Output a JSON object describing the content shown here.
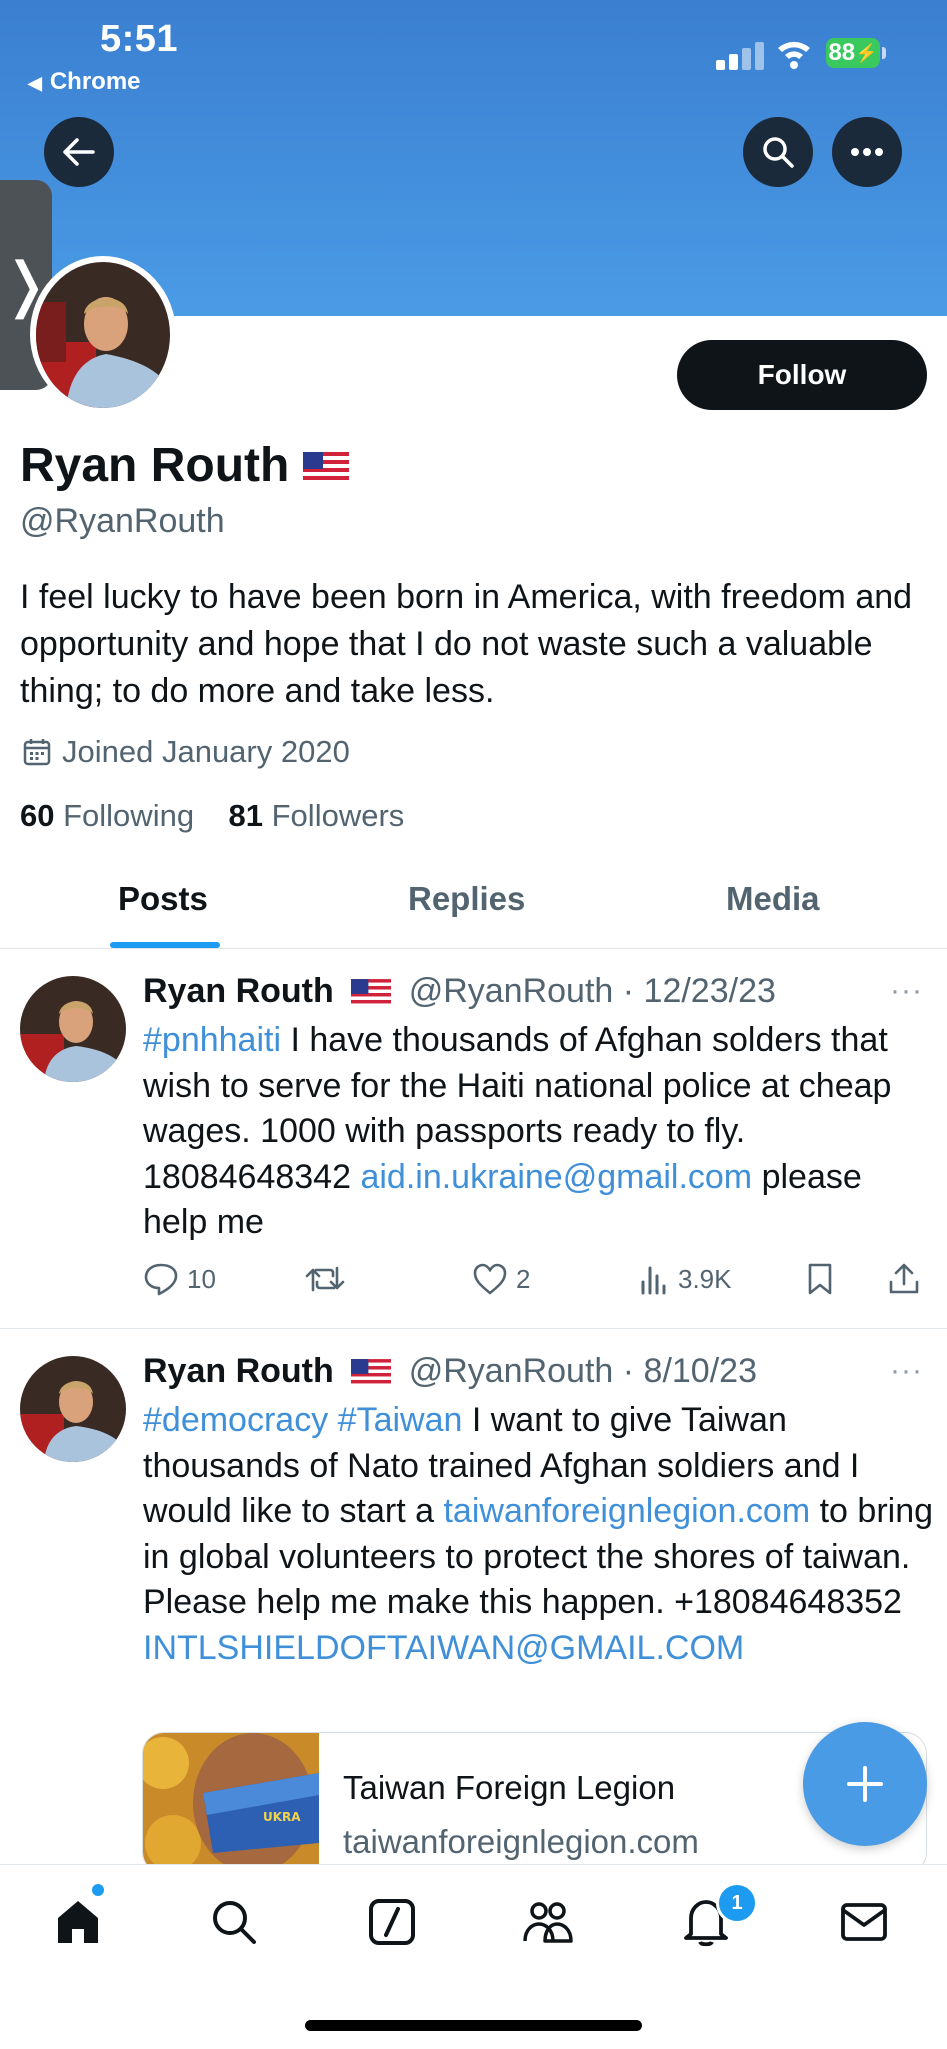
{
  "status_bar": {
    "time": "5:51",
    "back_app": "Chrome",
    "battery": "88"
  },
  "header": {
    "follow_label": "Follow"
  },
  "profile": {
    "name": "Ryan Routh",
    "handle": "@RyanRouth",
    "bio": "I feel lucky to have been born in America, with freedom and opportunity and hope that I do not waste such a valuable thing; to do more and take less.",
    "joined": "Joined January 2020",
    "following_count": "60",
    "following_label": "Following",
    "followers_count": "81",
    "followers_label": "Followers"
  },
  "tabs": [
    {
      "label": "Posts"
    },
    {
      "label": "Replies"
    },
    {
      "label": "Media"
    }
  ],
  "tweets": [
    {
      "name": "Ryan Routh",
      "handle": "@RyanRouth",
      "date": "· 12/23/23",
      "hashtag": "#pnhhaiti",
      "text1": " I have thousands of Afghan solders that wish to serve for the Haiti national police at cheap wages. 1000 with passports ready to fly. 18084648342 ",
      "email": "aid.in.ukraine@gmail.com",
      "text2": " please help me",
      "replies": "10",
      "likes": "2",
      "views": "3.9K"
    },
    {
      "name": "Ryan Routh",
      "handle": "@RyanRouth",
      "date": "· 8/10/23",
      "hashtag1": "#democracy",
      "hashtag2": "#Taiwan",
      "text1": " I want to give Taiwan thousands of Nato trained Afghan soldiers and I would like to start a ",
      "link": "taiwanforeignlegion.com",
      "text2": " to bring in global volunteers to protect the shores of taiwan.    Please help me make this happen. +18084648352",
      "email": "INTLSHIELDOFTAIWAN@GMAIL.COM",
      "card_title": "Taiwan Foreign Legion",
      "card_domain": "taiwanforeignlegion.com"
    }
  ],
  "nav": {
    "notifications_badge": "1"
  },
  "icons": [
    "back-arrow-icon",
    "search-icon",
    "more-icon",
    "calendar-icon",
    "reply-icon",
    "retweet-icon",
    "like-icon",
    "views-icon",
    "bookmark-icon",
    "share-icon",
    "home-icon",
    "explore-icon",
    "grok-icon",
    "communities-icon",
    "notifications-icon",
    "messages-icon",
    "compose-icon"
  ],
  "colors": {
    "banner": "#4a9be6",
    "link": "#3f8fd9",
    "accent": "#1d9bf0",
    "follow_bg": "#0f1419"
  }
}
